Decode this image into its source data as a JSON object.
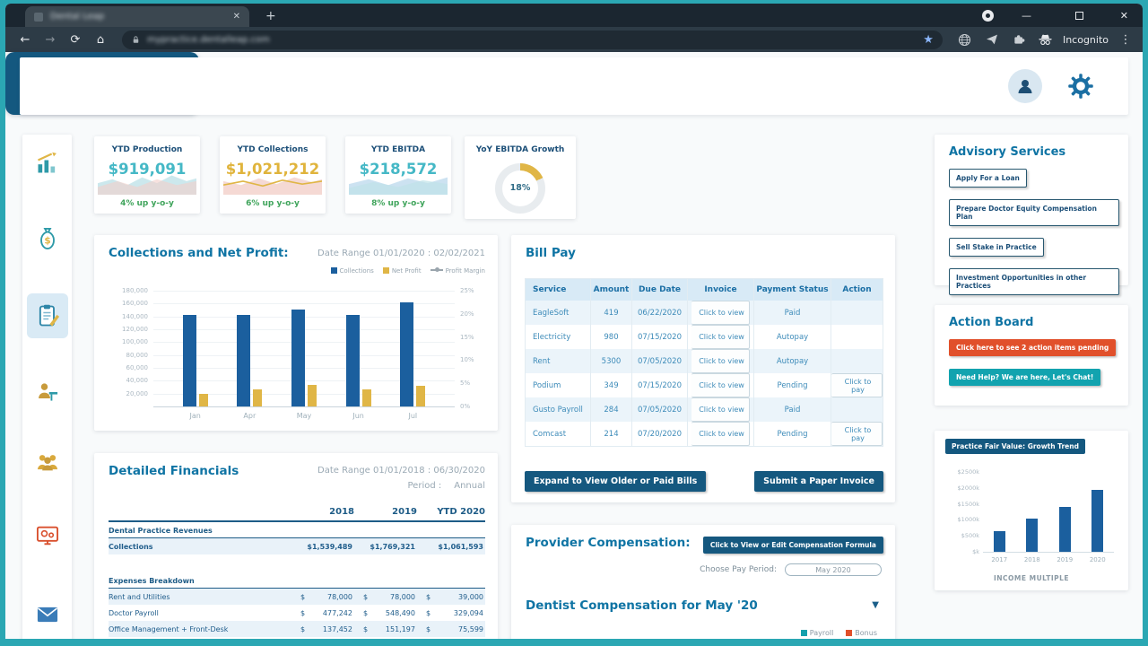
{
  "browser": {
    "tab_title": "Dental Leap",
    "url": "mypractice.dentalleap.com",
    "incognito_label": "Incognito"
  },
  "kpis": [
    {
      "title": "YTD Production",
      "value": "$919,091",
      "delta": "4% up y-o-y"
    },
    {
      "title": "YTD Collections",
      "value": "$1,021,212",
      "delta": "6% up y-o-y"
    },
    {
      "title": "YTD EBITDA",
      "value": "$218,572",
      "delta": "8% up y-o-y"
    },
    {
      "title": "YoY EBITDA Growth",
      "value": "18%"
    }
  ],
  "collections_chart": {
    "title": "Collections and Net Profit:",
    "date_range": "Date Range 01/01/2020 : 02/02/2021",
    "legend": [
      "Collections",
      "Net Profit",
      "Profit Margin"
    ],
    "months": [
      "Jan",
      "Apr",
      "May",
      "Jun",
      "Jul"
    ],
    "collections": [
      143000,
      143000,
      150000,
      143000,
      162000
    ],
    "net_profit": [
      20000,
      26000,
      33000,
      27000,
      32000
    ],
    "ymax": 180000,
    "left_axis": [
      "180,000",
      "160,000",
      "140,000",
      "120,000",
      "100,000",
      "80,000",
      "60,000",
      "40,000",
      "20,000"
    ],
    "right_axis": [
      "25%",
      "20%",
      "15%",
      "10%",
      "5%",
      "0%"
    ]
  },
  "detailed_financials": {
    "title": "Detailed Financials",
    "date_range": "Date Range 01/01/2018 : 06/30/2020",
    "period_label": "Period :",
    "period_value": "Annual",
    "columns": [
      "2018",
      "2019",
      "YTD 2020"
    ],
    "rows": [
      {
        "type": "section",
        "label": "Dental Practice Revenues"
      },
      {
        "type": "data",
        "label": "Collections",
        "values": [
          "$1,539,489",
          "$1,769,321",
          "$1,061,593"
        ],
        "bold": true,
        "shade": true
      },
      {
        "type": "spacer"
      },
      {
        "type": "section",
        "label": "Expenses Breakdown"
      },
      {
        "type": "data",
        "label": "Rent and Utilities",
        "currency": "$",
        "values": [
          "78,000",
          "78,000",
          "39,000"
        ],
        "shade": true
      },
      {
        "type": "data",
        "label": "Doctor Payroll",
        "currency": "$",
        "values": [
          "477,242",
          "548,490",
          "329,094"
        ]
      },
      {
        "type": "data",
        "label": "Office Management + Front-Desk",
        "currency": "$",
        "values": [
          "137,452",
          "151,197",
          "75,599"
        ],
        "shade": true
      }
    ]
  },
  "bill_pay": {
    "title": "Bill Pay",
    "columns": [
      "Service",
      "Amount",
      "Due Date",
      "Invoice",
      "Payment Status",
      "Action"
    ],
    "rows": [
      [
        "EagleSoft",
        "419",
        "06/22/2020",
        "Click to view",
        "Paid",
        ""
      ],
      [
        "Electricity",
        "980",
        "07/15/2020",
        "Click to view",
        "Autopay",
        ""
      ],
      [
        "Rent",
        "5300",
        "07/05/2020",
        "Click to view",
        "Autopay",
        ""
      ],
      [
        "Podium",
        "349",
        "07/15/2020",
        "Click to view",
        "Pending",
        "Click to pay"
      ],
      [
        "Gusto Payroll",
        "284",
        "07/05/2020",
        "Click to view",
        "Paid",
        ""
      ],
      [
        "Comcast",
        "214",
        "07/20/2020",
        "Click to view",
        "Pending",
        "Click to pay"
      ]
    ],
    "expand_button": "Expand to View Older or Paid Bills",
    "submit_button": "Submit a Paper Invoice"
  },
  "provider_compensation": {
    "title": "Provider Compensation:",
    "edit_button": "Click to View or Edit Compensation Formula",
    "pay_period_label": "Choose Pay Period:",
    "pay_period_value": "May 2020",
    "subtitle": "Dentist Compensation for May '20",
    "legend": [
      "Payroll",
      "Bonus"
    ]
  },
  "advisory": {
    "title": "Advisory Services",
    "buttons": [
      "Apply For a Loan",
      "Prepare Doctor Equity Compensation Plan",
      "Sell Stake in Practice",
      "Investment Opportunities in other Practices"
    ]
  },
  "action_board": {
    "title": "Action Board",
    "pending_button": "Click here to see 2 action items pending",
    "help_button": "Need Help? We are here, Let's Chat!"
  },
  "fair_value": {
    "title": "Practice Fair Value: Growth Trend",
    "years": [
      "2017",
      "2018",
      "2019",
      "2020"
    ],
    "values_k": [
      650,
      1050,
      1400,
      1950
    ],
    "ymax_k": 2500,
    "y_labels": [
      "$2500k",
      "$2000k",
      "$1500k",
      "$1000k",
      "$500k",
      "$k"
    ],
    "footer": "INCOME MULTIPLE"
  },
  "chat": {
    "label": "Let's Chat!"
  },
  "colors": {
    "accent_teal": "#2BA7B3",
    "navy": "#15587F",
    "heading_blue": "#0F74A4",
    "bar_blue": "#1B5F9E",
    "gold": "#E0B646",
    "green": "#3FA45B",
    "red": "#E1502B"
  }
}
